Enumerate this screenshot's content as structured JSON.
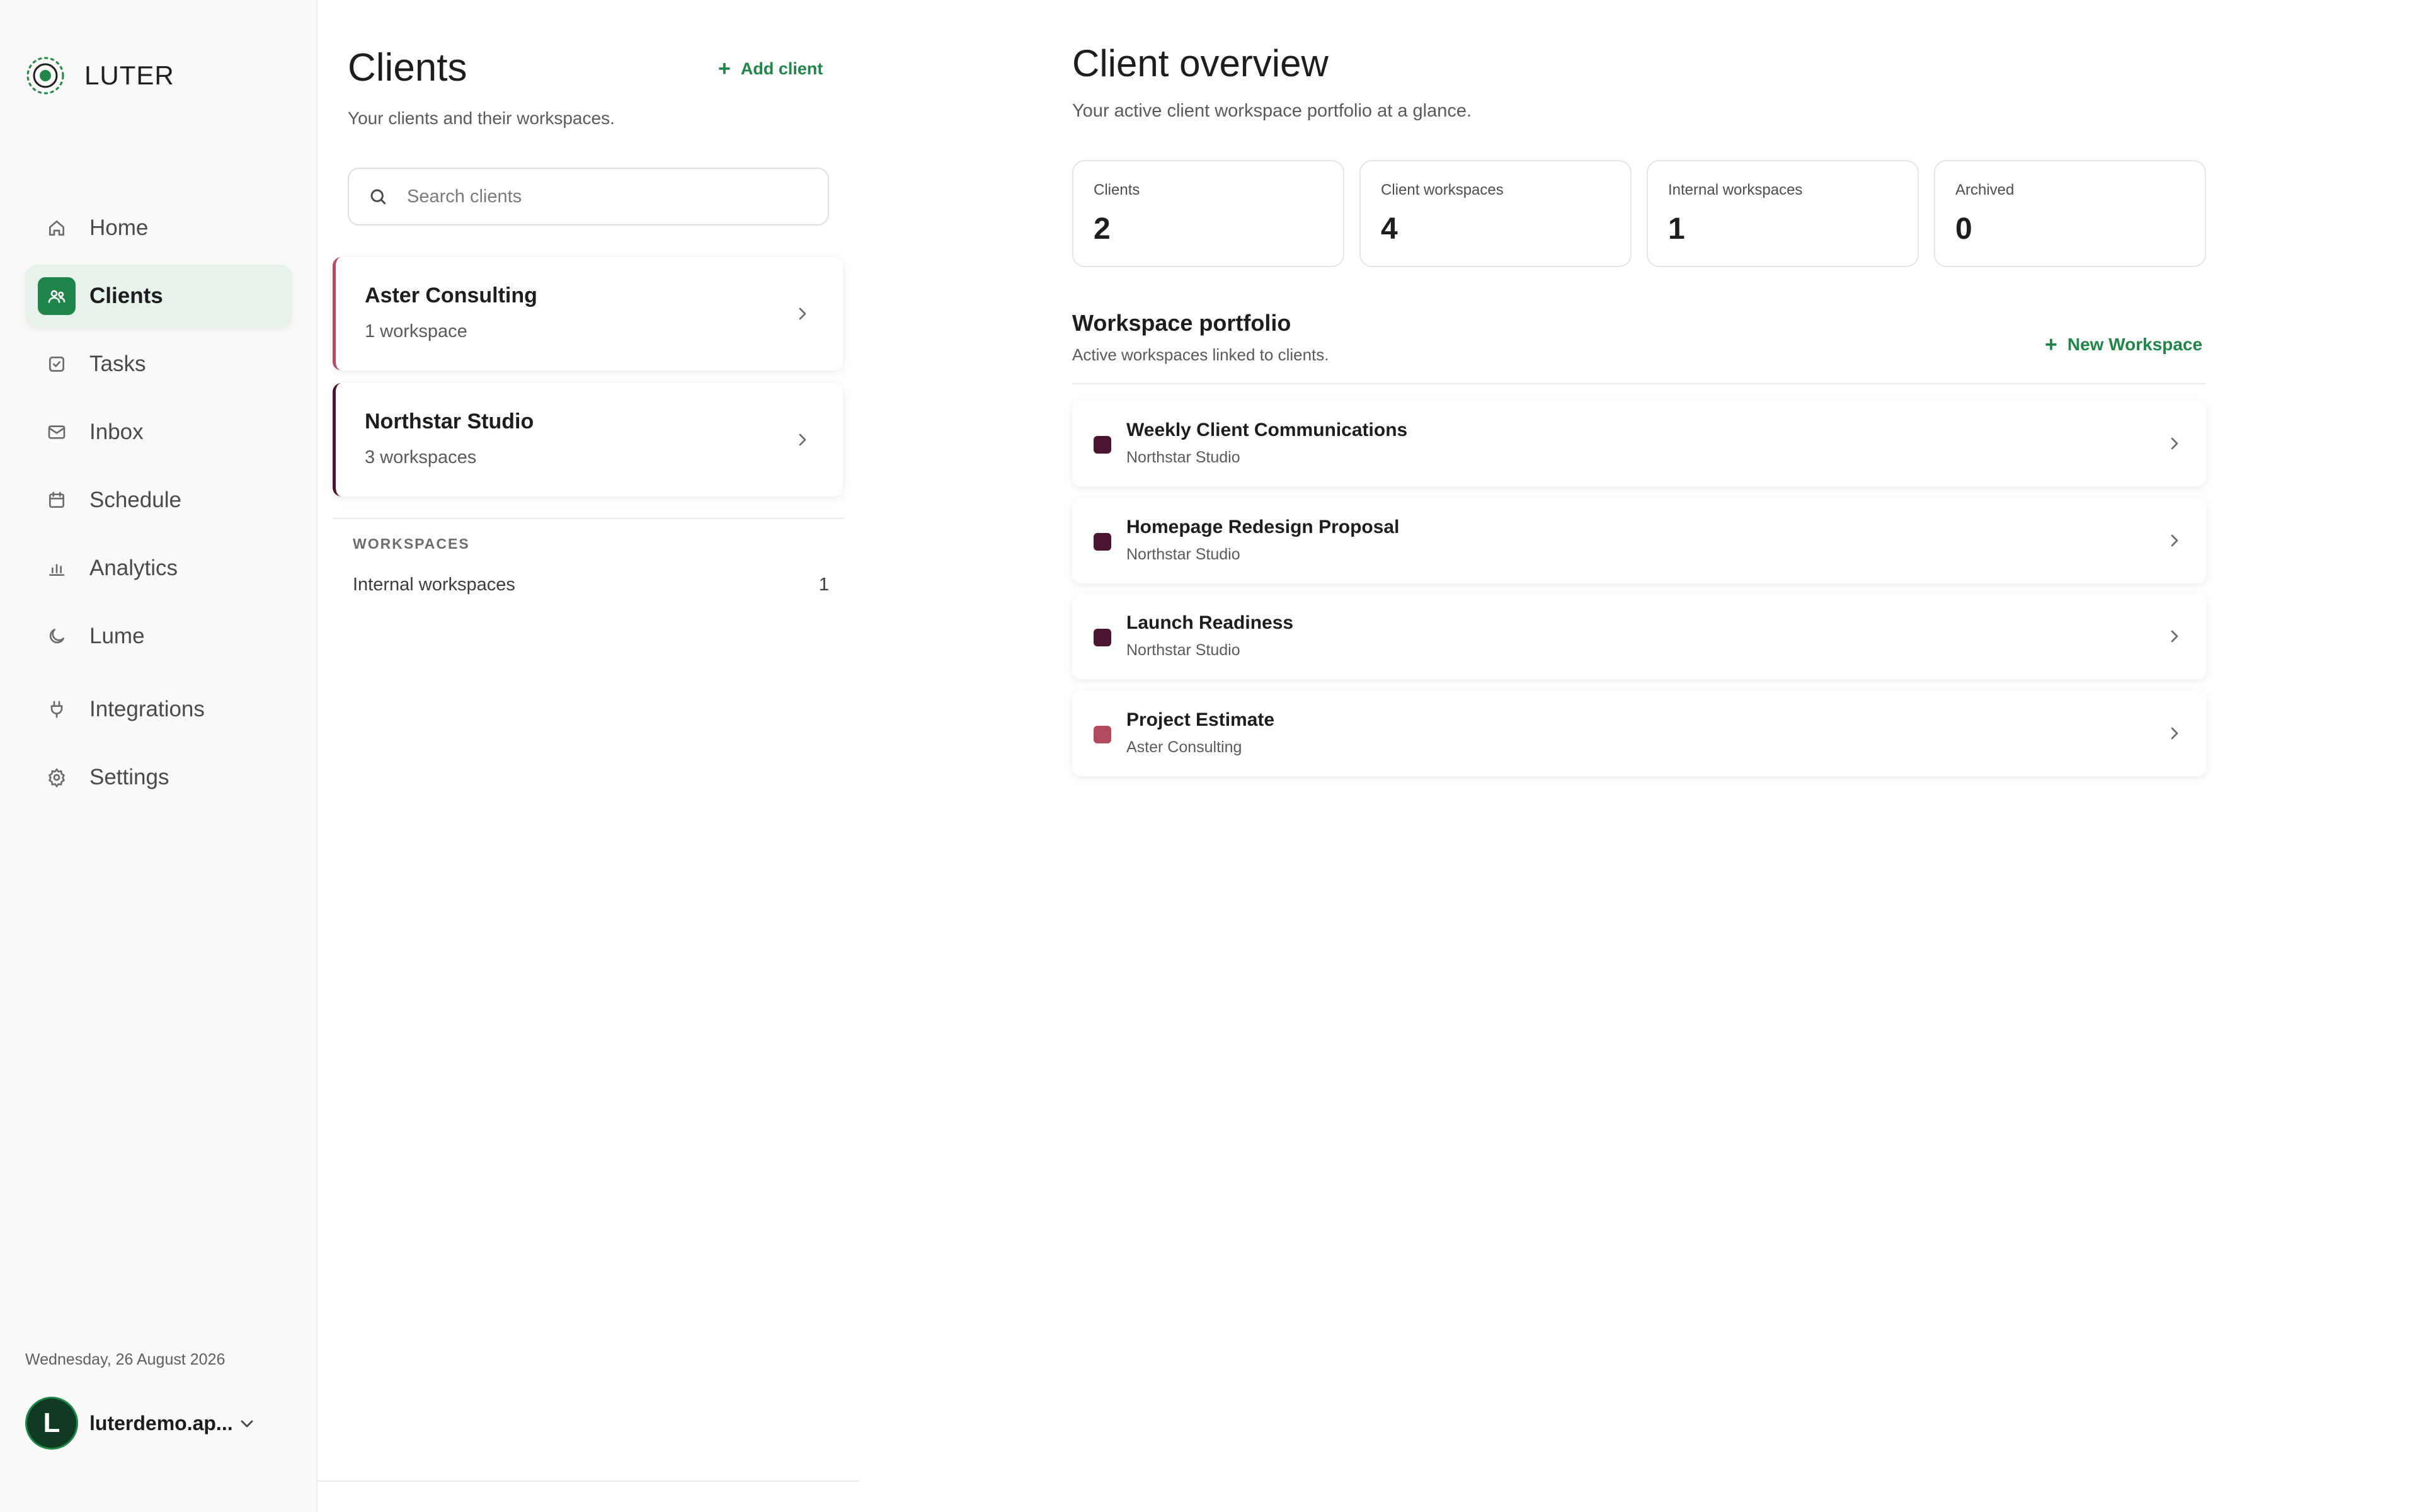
{
  "brand": {
    "name": "LUTER"
  },
  "colors": {
    "accent": "#208548",
    "aster": "#b24a5e",
    "northstar": "#4a1530"
  },
  "nav": {
    "items": [
      {
        "label": "Home",
        "icon": "home-icon"
      },
      {
        "label": "Clients",
        "icon": "users-icon",
        "active": true
      },
      {
        "label": "Tasks",
        "icon": "checkbox-icon"
      },
      {
        "label": "Inbox",
        "icon": "mail-icon"
      },
      {
        "label": "Schedule",
        "icon": "calendar-icon"
      },
      {
        "label": "Analytics",
        "icon": "bar-chart-icon"
      },
      {
        "label": "Lume",
        "icon": "moon-icon"
      },
      {
        "label": "Integrations",
        "icon": "plug-icon"
      },
      {
        "label": "Settings",
        "icon": "gear-icon"
      }
    ]
  },
  "footer": {
    "date": "Wednesday, 26 August 2026",
    "avatar_letter": "L",
    "user": "luterdemo.ap..."
  },
  "clients_panel": {
    "title": "Clients",
    "subtitle": "Your clients and their workspaces.",
    "add_label": "Add client",
    "search_placeholder": "Search clients",
    "clients": [
      {
        "name": "Aster Consulting",
        "count": "1 workspace"
      },
      {
        "name": "Northstar Studio",
        "count": "3 workspaces"
      }
    ],
    "section_label": "WORKSPACES",
    "internal_label": "Internal workspaces",
    "internal_count": "1"
  },
  "overview": {
    "title": "Client overview",
    "subtitle": "Your active client workspace portfolio at a glance.",
    "stats": [
      {
        "label": "Clients",
        "value": "2"
      },
      {
        "label": "Client workspaces",
        "value": "4"
      },
      {
        "label": "Internal workspaces",
        "value": "1"
      },
      {
        "label": "Archived",
        "value": "0"
      }
    ],
    "portfolio_title": "Workspace portfolio",
    "portfolio_sub": "Active workspaces linked to clients.",
    "new_label": "New Workspace",
    "workspaces": [
      {
        "name": "Weekly Client Communications",
        "client": "Northstar Studio"
      },
      {
        "name": "Homepage Redesign Proposal",
        "client": "Northstar Studio"
      },
      {
        "name": "Launch Readiness",
        "client": "Northstar Studio"
      },
      {
        "name": "Project Estimate",
        "client": "Aster Consulting"
      }
    ]
  }
}
